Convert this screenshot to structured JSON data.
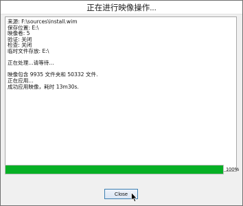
{
  "window": {
    "title": "正在进行映像操作..."
  },
  "log": {
    "lines": [
      "来源: F:\\sources\\install.wim",
      "保存位置: E:\\",
      "映像卷: 5",
      "验证: 关闭",
      "检查: 关闭",
      "临时文件存放: E:\\",
      "",
      "正在处理...请等待...",
      "",
      "映像包含 9935 文件夹和 50332 文件.",
      "正在应用...",
      "成功应用映像，耗时 13m30s."
    ]
  },
  "progress": {
    "percent": 100,
    "label": "100%",
    "color": "#06b025"
  },
  "buttons": {
    "close_label": "Close"
  }
}
